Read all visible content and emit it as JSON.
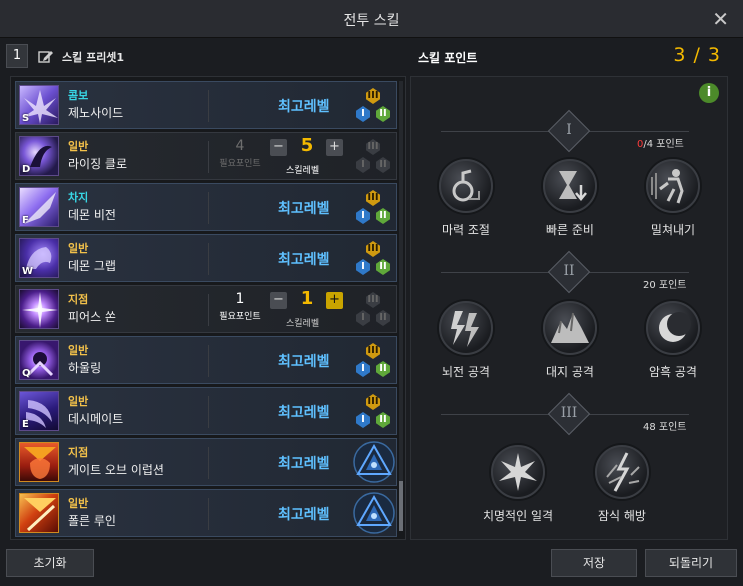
{
  "window": {
    "title": "전투 스킬"
  },
  "preset": {
    "number": "1",
    "name": "스킬 프리셋1"
  },
  "skill_points": {
    "label": "스킬 포인트",
    "count": "3 / 3"
  },
  "skills": [
    {
      "key": "S",
      "type": "콤보",
      "type_color": "#38d7e6",
      "name": "제노사이드",
      "status": "최고레벨"
    },
    {
      "key": "D",
      "type": "일반",
      "type_color": "#f3c14a",
      "name": "라이징 클로",
      "required_points": "4",
      "required_label": "필요포인트",
      "level": "5",
      "level_label": "스킬레벨"
    },
    {
      "key": "F",
      "type": "차지",
      "type_color": "#38d7e6",
      "name": "데몬 비전",
      "status": "최고레벨"
    },
    {
      "key": "W",
      "type": "일반",
      "type_color": "#f3c14a",
      "name": "데몬 그랩",
      "status": "최고레벨"
    },
    {
      "key": "",
      "type": "지점",
      "type_color": "#f3c14a",
      "name": "피어스 쏜",
      "required_points": "1",
      "required_label": "필요포인트",
      "level": "1",
      "level_label": "스킬레벨"
    },
    {
      "key": "Q",
      "type": "일반",
      "type_color": "#f3c14a",
      "name": "하울링",
      "status": "최고레벨"
    },
    {
      "key": "E",
      "type": "일반",
      "type_color": "#f3c14a",
      "name": "데시메이트",
      "status": "최고레벨"
    },
    {
      "key": "",
      "type": "지점",
      "type_color": "#f3c14a",
      "name": "게이트 오브 이럽션",
      "status": "최고레벨"
    },
    {
      "key": "",
      "type": "일반",
      "type_color": "#f3c14a",
      "name": "폴른 루인",
      "status": "최고레벨"
    }
  ],
  "tiers": [
    {
      "numeral": "I",
      "points_used": "0",
      "points_rest": "/4 포인트",
      "nodes": [
        {
          "label": "마력 조절",
          "icon": "potion-icon"
        },
        {
          "label": "빠른 준비",
          "icon": "hourglass-icon"
        },
        {
          "label": "밀쳐내기",
          "icon": "push-icon"
        }
      ]
    },
    {
      "numeral": "II",
      "points": "20 포인트",
      "nodes": [
        {
          "label": "뇌전 공격",
          "icon": "lightning-icon"
        },
        {
          "label": "대지 공격",
          "icon": "earth-icon"
        },
        {
          "label": "암흑 공격",
          "icon": "moon-icon"
        }
      ]
    },
    {
      "numeral": "III",
      "points": "48 포인트",
      "nodes": [
        {
          "label": "치명적인 일격",
          "icon": "burst-icon"
        },
        {
          "label": "잠식 해방",
          "icon": "release-icon"
        }
      ]
    }
  ],
  "buttons": {
    "reset": "초기화",
    "save": "저장",
    "revert": "되돌리기"
  }
}
